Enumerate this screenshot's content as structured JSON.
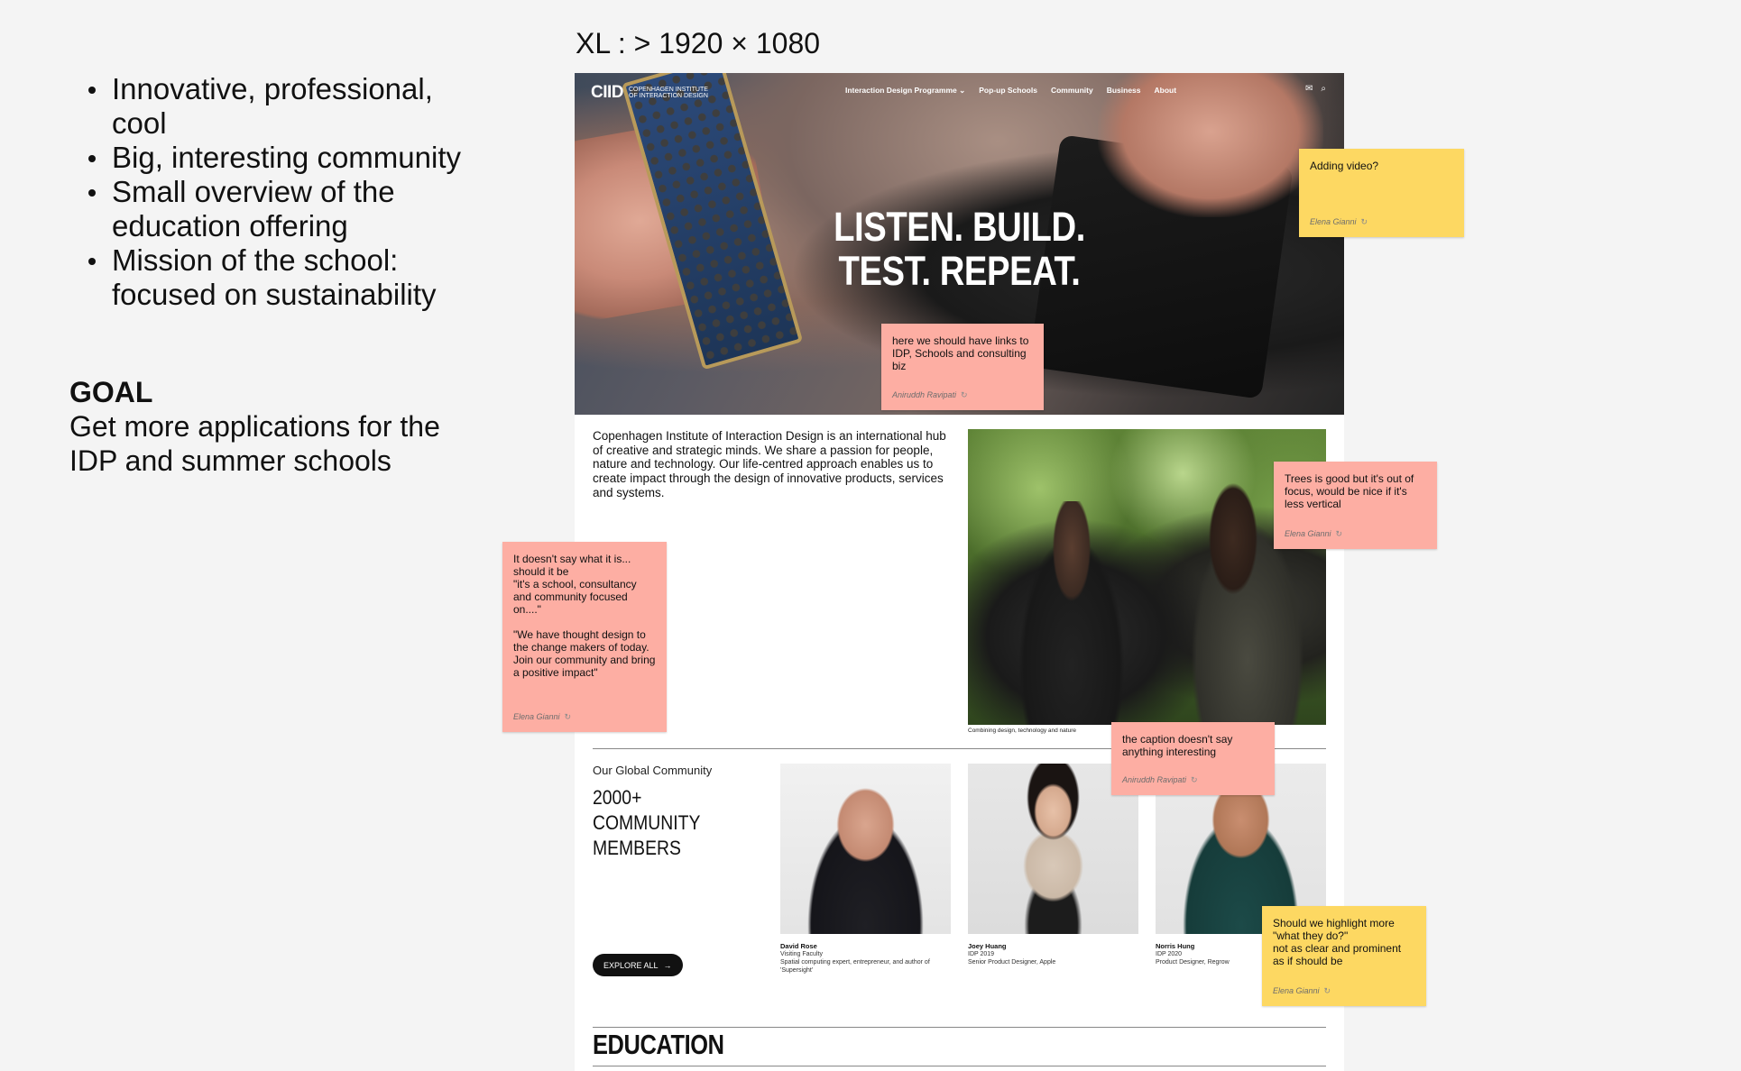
{
  "bullets": [
    "Innovative, professional, cool",
    "Big, interesting community",
    "Small overview of the education offering",
    "Mission of the school: focused on sustainability"
  ],
  "goal": {
    "title": "GOAL",
    "text": "Get more applications for the IDP and summer schools"
  },
  "frame_label": "XL : > 1920 × 1080",
  "site": {
    "logo_mark": "CIID",
    "logo_text": "COPENHAGEN INSTITUTE OF INTERACTION DESIGN",
    "nav": [
      "Interaction Design Programme ⌄",
      "Pop-up Schools",
      "Community",
      "Business",
      "About"
    ],
    "nav_icons": {
      "mail": "✉",
      "search": "⌕"
    },
    "hero_line1": "LISTEN. BUILD.",
    "hero_line2": "TEST. REPEAT.",
    "intro": "Copenhagen Institute of Interaction Design is an international hub of creative and strategic minds. We share a passion for people, nature and technology. Our life-centred approach enables us to create impact through the design of innovative products, services and systems.",
    "photo_caption": "Combining design, technology and nature",
    "community_kicker": "Our Global Community",
    "community_title": "2000+ COMMUNITY MEMBERS",
    "explore_label": "EXPLORE ALL",
    "explore_icon": "→",
    "members": [
      {
        "name": "David Rose",
        "role": "Visiting Faculty",
        "desc": "Spatial computing expert, entrepreneur, and author of 'Supersight'"
      },
      {
        "name": "Joey Huang",
        "role": "IDP 2019",
        "desc": "Senior Product Designer, Apple"
      },
      {
        "name": "Norris Hung",
        "role": "IDP 2020",
        "desc": "Product Designer, Regrow"
      }
    ],
    "education_title": "EDUCATION"
  },
  "stickies": {
    "video": {
      "text": "Adding video?",
      "author": "Elena Gianni",
      "color": "#fdd862"
    },
    "links": {
      "text": "here we should have links to IDP, Schools and consulting biz",
      "author": "Aniruddh Ravipati",
      "color": "#fdaea3"
    },
    "trees": {
      "text": "Trees is good but it's out of focus, would be nice if it's less vertical",
      "author": "Elena Gianni",
      "color": "#fdaea3"
    },
    "about": {
      "text": "It doesn't say what it is... should it be\n\"it's a school, consultancy and community focused on....\"\n\n\"We have thought design to the change makers of today. Join our community and bring a positive impact\"",
      "author": "Elena Gianni",
      "color": "#fdaea3"
    },
    "caption": {
      "text": "the caption doesn't say anything interesting",
      "author": "Aniruddh Ravipati",
      "color": "#fdaea3"
    },
    "highlight": {
      "text": "Should we highlight more \"what they do?\"\nnot as clear and prominent as if should be",
      "author": "Elena Gianni",
      "color": "#fdd862"
    }
  },
  "reply_icon": "↻"
}
